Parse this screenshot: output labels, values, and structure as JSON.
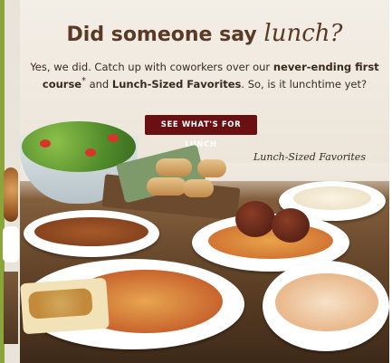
{
  "promo": {
    "headline_prefix": "Did someone say",
    "headline_script": "lunch?",
    "body_part1": "Yes, we did. Catch up with coworkers over our ",
    "body_bold1": "never-ending first course",
    "body_asterisk": "*",
    "body_part2": " and ",
    "body_bold2": "Lunch-Sized Favorites",
    "body_part3": ". So, is it lunchtime yet?",
    "cta_label": "SEE WHAT'S FOR LUNCH",
    "script_label": "Lunch-Sized Favorites"
  },
  "colors": {
    "headline": "#5a3a24",
    "cta_bg": "#6a0f12",
    "cta_text": "#ffffff",
    "left_accent": "#8aa63a"
  }
}
